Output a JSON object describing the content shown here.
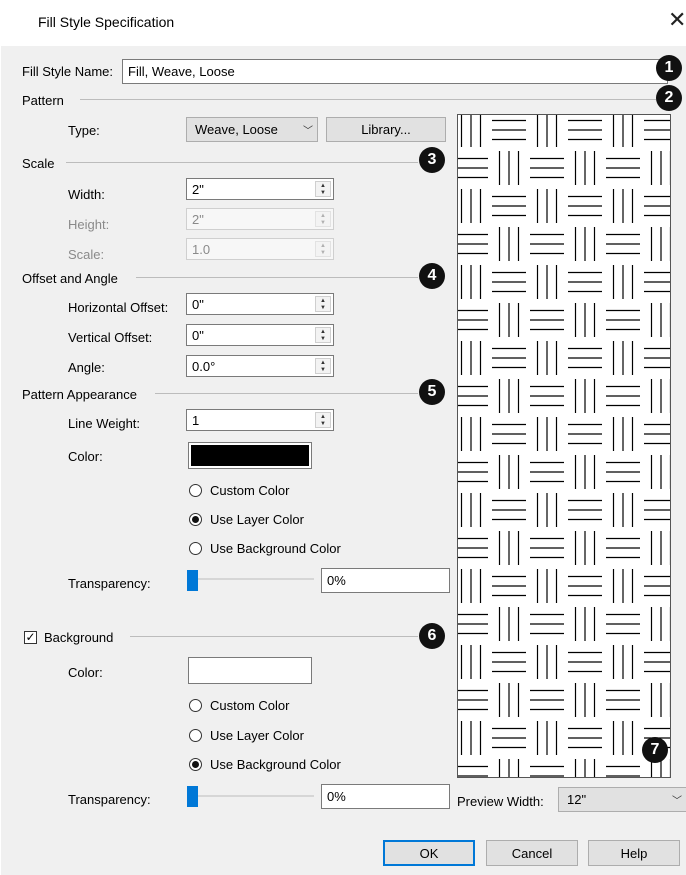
{
  "dialog": {
    "title": "Fill Style Specification",
    "close_glyph": "✕"
  },
  "fill_style_name": {
    "label": "Fill Style Name:",
    "value": "Fill, Weave, Loose"
  },
  "pattern": {
    "heading": "Pattern",
    "type_label": "Type:",
    "type_value": "Weave, Loose",
    "library_button": "Library..."
  },
  "scale": {
    "heading": "Scale",
    "width_label": "Width:",
    "width_value": "2\"",
    "height_label": "Height:",
    "height_value": "2\"",
    "scale_label": "Scale:",
    "scale_value": "1.0"
  },
  "offset_angle": {
    "heading": "Offset and Angle",
    "horizontal_label": "Horizontal Offset:",
    "horizontal_value": "0\"",
    "vertical_label": "Vertical Offset:",
    "vertical_value": "0\"",
    "angle_label": "Angle:",
    "angle_value": "0.0°"
  },
  "pattern_appearance": {
    "heading": "Pattern Appearance",
    "line_weight_label": "Line Weight:",
    "line_weight_value": "1",
    "color_label": "Color:",
    "color_hex": "#000000",
    "radio_custom": "Custom Color",
    "radio_layer": "Use Layer Color",
    "radio_background": "Use Background Color",
    "selected": "Use Layer Color",
    "transparency_label": "Transparency:",
    "transparency_value": "0%",
    "transparency_level": 0
  },
  "background": {
    "heading": "Background",
    "checked": true,
    "check_glyph": "✓",
    "color_label": "Color:",
    "color_hex": "#ffffff",
    "radio_custom": "Custom Color",
    "radio_layer": "Use Layer Color",
    "radio_background": "Use Background Color",
    "selected": "Use Background Color",
    "transparency_label": "Transparency:",
    "transparency_value": "0%",
    "transparency_level": 0
  },
  "preview": {
    "width_label": "Preview Width:",
    "width_value": "12\""
  },
  "callouts": [
    "1",
    "2",
    "3",
    "4",
    "5",
    "6",
    "7"
  ],
  "buttons": {
    "ok": "OK",
    "cancel": "Cancel",
    "help": "Help"
  },
  "icons": {
    "spin_up": "▲",
    "spin_down": "▼",
    "chevron": "﹀"
  }
}
